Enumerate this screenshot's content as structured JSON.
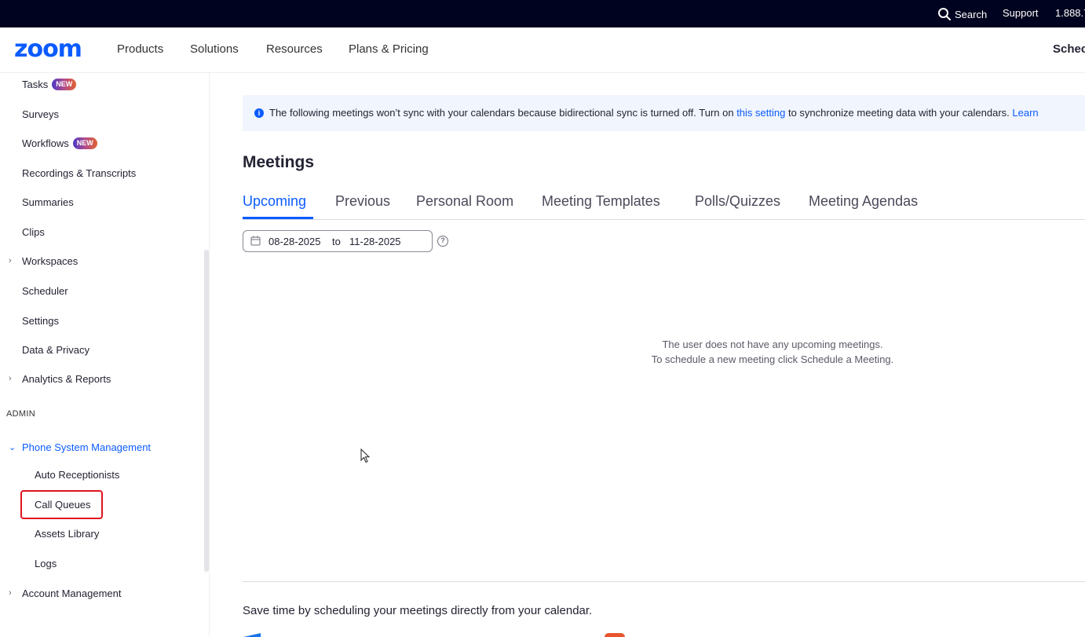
{
  "topbar": {
    "search_label": "Search",
    "support_label": "Support",
    "phone_label": "1.888.7"
  },
  "nav": {
    "logo": "zoom",
    "products": "Products",
    "solutions": "Solutions",
    "resources": "Resources",
    "plans": "Plans & Pricing",
    "schedule": "Schec"
  },
  "sidebar": {
    "new_badge": "NEW",
    "items": [
      {
        "label": "Tasks"
      },
      {
        "label": "Surveys"
      },
      {
        "label": "Workflows"
      },
      {
        "label": "Recordings & Transcripts"
      },
      {
        "label": "Summaries"
      },
      {
        "label": "Clips"
      },
      {
        "label": "Workspaces"
      },
      {
        "label": "Scheduler"
      },
      {
        "label": "Settings"
      },
      {
        "label": "Data & Privacy"
      },
      {
        "label": "Analytics & Reports"
      }
    ],
    "admin_section": "ADMIN",
    "admin_items": [
      {
        "label": "Phone System Management"
      },
      {
        "label": "Auto Receptionists"
      },
      {
        "label": "Call Queues"
      },
      {
        "label": "Assets Library"
      },
      {
        "label": "Logs"
      },
      {
        "label": "Account Management"
      }
    ]
  },
  "notice": {
    "text_before": "The following meetings won’t sync with your calendars because bidirectional sync is turned off. Turn on ",
    "link": "this setting",
    "text_after": " to synchronize meeting data with your calendars.  ",
    "learn": "Learn"
  },
  "main": {
    "title": "Meetings",
    "tabs": [
      {
        "label": "Upcoming"
      },
      {
        "label": "Previous"
      },
      {
        "label": "Personal Room"
      },
      {
        "label": "Meeting Templates"
      },
      {
        "label": "Polls/Quizzes"
      },
      {
        "label": "Meeting Agendas"
      }
    ],
    "date_from": "08-28-2025",
    "date_to_label": "to",
    "date_to": "11-28-2025",
    "help_glyph": "?",
    "empty_line1": "The user does not have any upcoming meetings.",
    "empty_line2": "To schedule a new meeting click Schedule a Meeting.",
    "footer_text": "Save time by scheduling your meetings directly from your calendar."
  },
  "colors": {
    "accent": "#0b5cff",
    "topbar": "#00031f",
    "highlight": "#e0141e"
  }
}
